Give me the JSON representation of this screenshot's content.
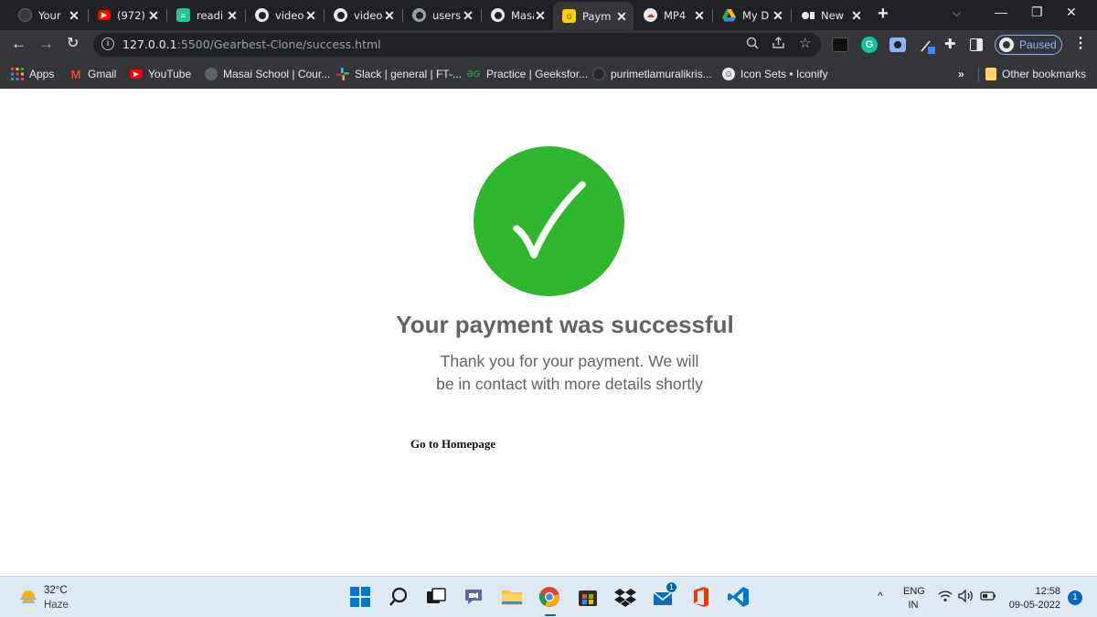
{
  "browser": {
    "tabs": [
      {
        "title": "Your",
        "icon": "github-icon",
        "color": "#24292e"
      },
      {
        "title": "(972)",
        "icon": "youtube-icon",
        "color": "#ff0000"
      },
      {
        "title": "readi",
        "icon": "readme-icon",
        "color": "#1ec998"
      },
      {
        "title": "video",
        "icon": "globe-icon",
        "color": "#e8eaed"
      },
      {
        "title": "video",
        "icon": "globe-icon",
        "color": "#e8eaed"
      },
      {
        "title": "users",
        "icon": "globe-icon",
        "color": "#9aa0a6"
      },
      {
        "title": "Masa",
        "icon": "globe-icon",
        "color": "#e8eaed"
      },
      {
        "title": "Paym",
        "icon": "payment-icon",
        "color": "#fbd000",
        "active": true
      },
      {
        "title": "MP4",
        "icon": "cloud-icon",
        "color": "#e8eaed"
      },
      {
        "title": "My D",
        "icon": "google-drive-icon",
        "color": "#34a853"
      },
      {
        "title": "New",
        "icon": "record-icon",
        "color": "#e8eaed"
      }
    ],
    "url": {
      "host": "127.0.0.1",
      "path": ":5500/Gearbest-Clone/success.html"
    },
    "profile_status": "Paused",
    "bookmarks": [
      {
        "label": "Apps",
        "icon": "apps-grid-icon"
      },
      {
        "label": "Gmail",
        "icon": "gmail-icon"
      },
      {
        "label": "YouTube",
        "icon": "youtube-icon"
      },
      {
        "label": "Masai School | Cour...",
        "icon": "globe-icon"
      },
      {
        "label": "Slack | general | FT-...",
        "icon": "slack-icon"
      },
      {
        "label": "Practice | Geeksfor...",
        "icon": "geeksforgeeks-icon"
      },
      {
        "label": "purimetlamuralikris...",
        "icon": "github-icon"
      },
      {
        "label": "Icon Sets • Iconify",
        "icon": "iconify-icon"
      }
    ],
    "bookmarks_more": "»",
    "other_bookmarks": "Other bookmarks"
  },
  "page": {
    "title": "Your payment was successful",
    "message": "Thank you for your payment. We will be in contact with more details shortly",
    "home_link": "Go to Homepage",
    "success_color": "#2eb62c"
  },
  "taskbar": {
    "weather": {
      "temp": "32°C",
      "condition": "Haze"
    },
    "language": {
      "line1": "ENG",
      "line2": "IN"
    },
    "clock": {
      "time": "12:58",
      "date": "09-05-2022"
    },
    "notifications": "1",
    "mail_badge": "1"
  }
}
